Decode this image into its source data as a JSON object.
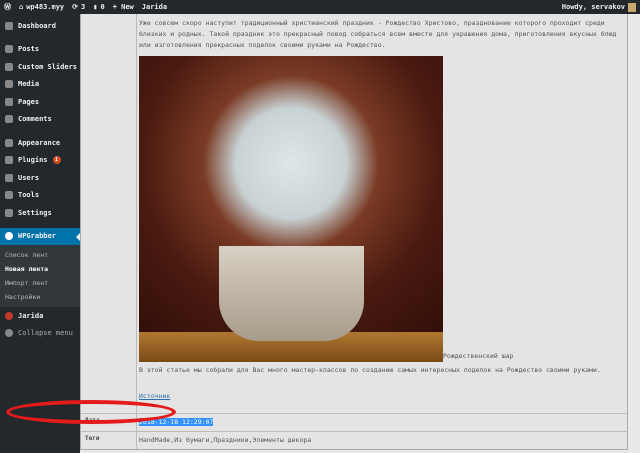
{
  "adminbar": {
    "site": "wp483.myy",
    "updates": "3",
    "comments": "0",
    "new": "+ New",
    "theme": "Jarida",
    "howdy": "Howdy, servakov"
  },
  "sidebar": {
    "items": [
      {
        "label": "Dashboard"
      },
      {
        "label": "Posts"
      },
      {
        "label": "Custom Sliders"
      },
      {
        "label": "Media"
      },
      {
        "label": "Pages"
      },
      {
        "label": "Comments"
      },
      {
        "label": "Appearance"
      },
      {
        "label": "Plugins",
        "badge": "1"
      },
      {
        "label": "Users"
      },
      {
        "label": "Tools"
      },
      {
        "label": "Settings"
      },
      {
        "label": "WPGrabber"
      }
    ],
    "submenu": [
      "Список лент",
      "Новая лента",
      "Импорт лент",
      "Настройки"
    ],
    "jarida": "Jarida",
    "collapse": "Collapse menu"
  },
  "content": {
    "intro": "Уже совсем скоро наступит традиционный христианский праздник - Рождество Христово, празднование которого проходит среди близких и родных. Такой праздник это прекрасный повод собраться всем вместе для украшения дома, приготовления вкусных блюд или изготовления прекрасных поделок своими руками на Рождество.",
    "caption": "Рождественский шар",
    "para": "В этой статье мы собрали для Вас много мастер-классов по созданию самых интересных поделок на Рождество своими руками.",
    "source": "Источник"
  },
  "rows": {
    "date_label": "Дата",
    "date_value": "2018-12-18 12:29:07",
    "tags_label": "Теги",
    "tags_value": "HandMade,Из бумаги,Праздники,Элементы декора"
  },
  "colors": {
    "adminbar": "#23282d",
    "accent": "#0073aa",
    "highlight": "#e31b1b"
  }
}
